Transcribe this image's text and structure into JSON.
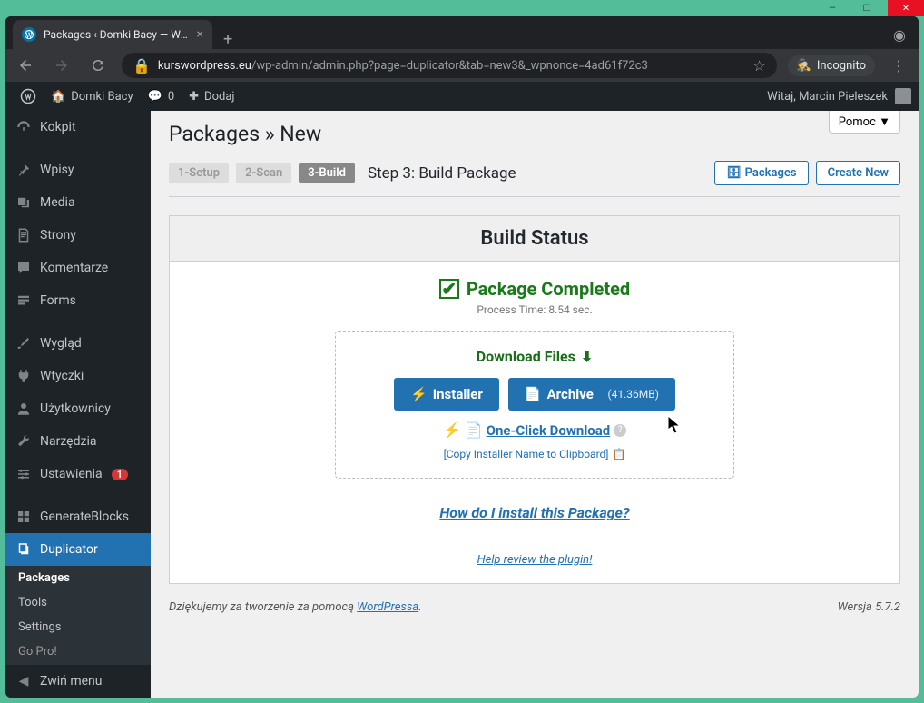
{
  "window": {
    "title": "Packages ‹ Domki Bacy — WordPress"
  },
  "browser": {
    "url_host": "kurswordpress.eu",
    "url_path": "/wp-admin/admin.php?page=duplicator&tab=new3&_wpnonce=4ad61f72c3",
    "incognito": "Incognito"
  },
  "wpbar": {
    "site": "Domki Bacy",
    "comments": "0",
    "add": "Dodaj",
    "welcome": "Witaj, Marcin Pieleszek"
  },
  "sidebar": {
    "items": [
      {
        "label": "Kokpit",
        "icon": "dashboard"
      },
      {
        "label": "Wpisy",
        "icon": "pin"
      },
      {
        "label": "Media",
        "icon": "media"
      },
      {
        "label": "Strony",
        "icon": "page"
      },
      {
        "label": "Komentarze",
        "icon": "comment"
      },
      {
        "label": "Forms",
        "icon": "forms"
      },
      {
        "label": "Wygląd",
        "icon": "brush"
      },
      {
        "label": "Wtyczki",
        "icon": "plugin"
      },
      {
        "label": "Użytkownicy",
        "icon": "users"
      },
      {
        "label": "Narzędzia",
        "icon": "tools"
      },
      {
        "label": "Ustawienia",
        "icon": "settings",
        "badge": "1"
      },
      {
        "label": "GenerateBlocks",
        "icon": "blocks"
      },
      {
        "label": "Duplicator",
        "icon": "duplicator"
      }
    ],
    "submenu": [
      {
        "label": "Packages"
      },
      {
        "label": "Tools"
      },
      {
        "label": "Settings"
      },
      {
        "label": "Go Pro!"
      }
    ],
    "collapse": "Zwiń menu"
  },
  "main": {
    "help_tab": "Pomoc ▼",
    "title": "Packages » New",
    "steps": {
      "s1": "1-Setup",
      "s2": "2-Scan",
      "s3": "3-Build",
      "label": "Step 3: Build Package"
    },
    "buttons": {
      "packages": "Packages",
      "create": "Create New"
    },
    "panel": {
      "header": "Build Status",
      "completed": "Package Completed",
      "process_time_label": "Process Time:",
      "process_time_value": "8.54 sec.",
      "download_heading": "Download Files",
      "installer": "Installer",
      "archive": "Archive",
      "archive_size": "(41.36MB)",
      "one_click": "One-Click Download",
      "copy_name": "[Copy Installer Name to Clipboard]",
      "install_help": "How do I install this Package?",
      "review": "Help review the plugin!"
    },
    "footer": {
      "thanks_pre": "Dziękujemy za tworzenie za pomocą ",
      "thanks_link": "WordPressa",
      "version": "Wersja 5.7.2"
    }
  }
}
